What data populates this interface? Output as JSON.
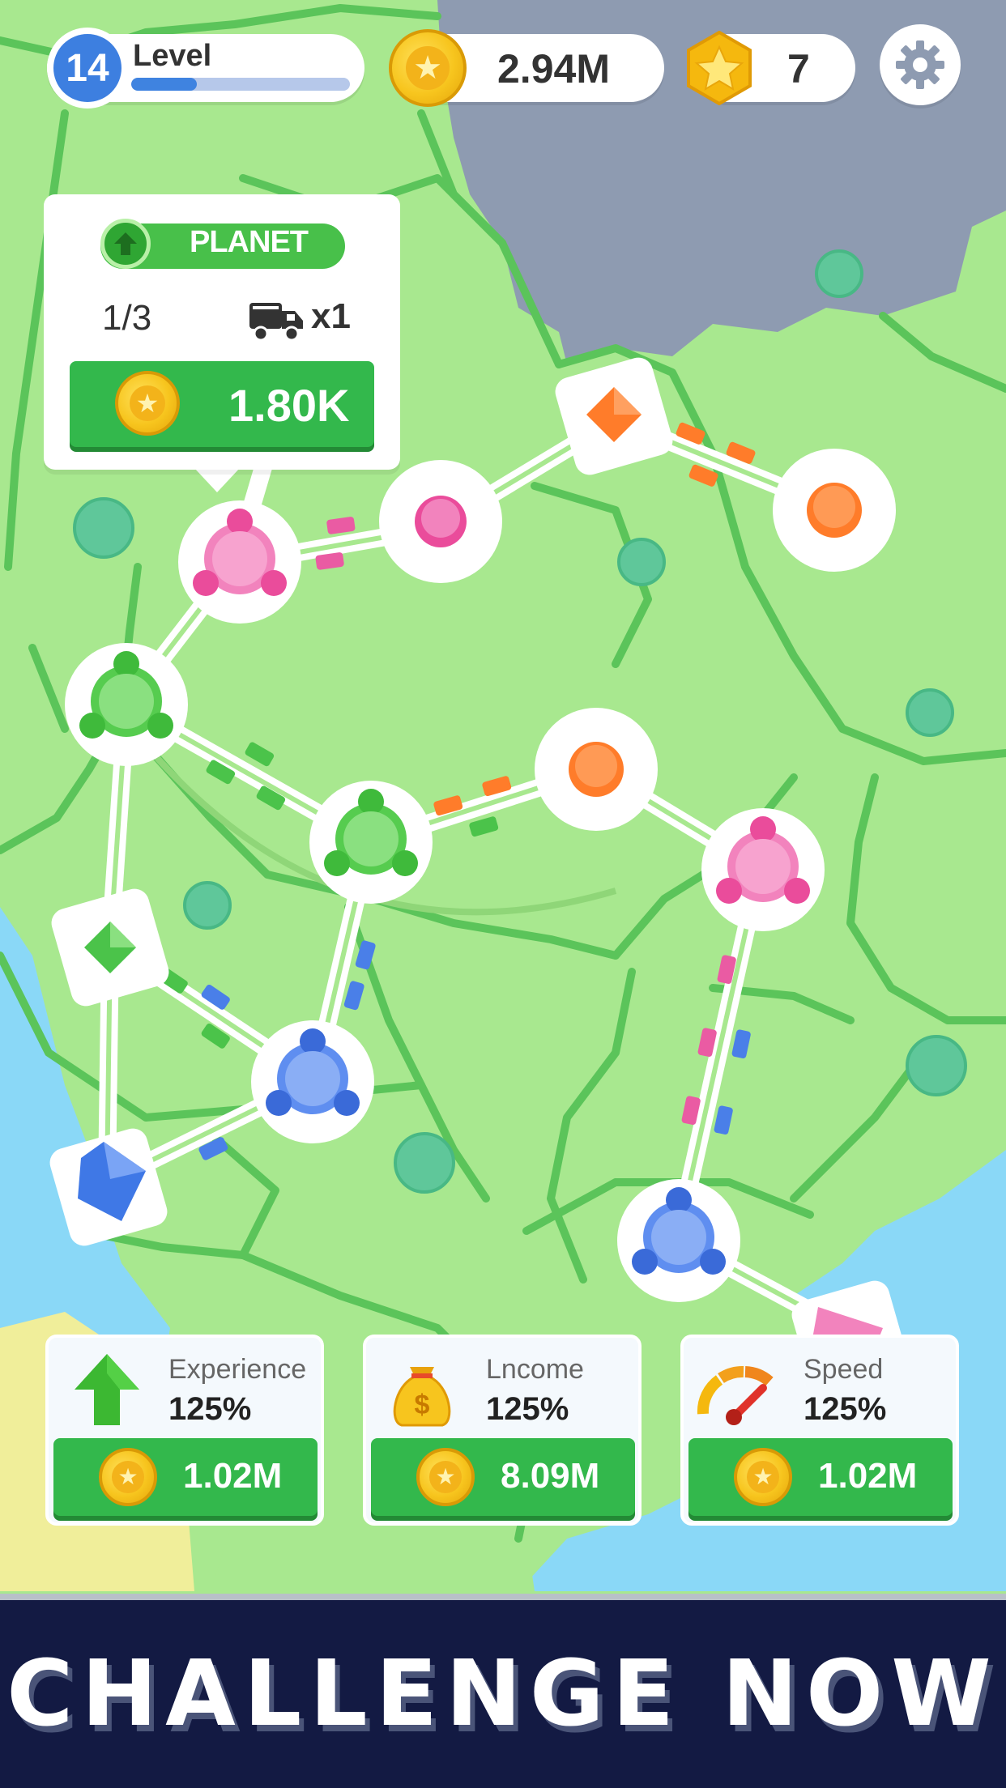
{
  "hud": {
    "level_number": "14",
    "level_label": "Level",
    "level_progress": 0.3,
    "coins_value": "2.94M",
    "stars_value": "7",
    "coin_icon": "coin-star-icon",
    "star_icon": "star-hex-icon",
    "settings_icon": "gear-icon"
  },
  "planet_card": {
    "tag_label": "PLANET",
    "progress": "1/3",
    "trucks_count": "x1",
    "buy_cost": "1.80K"
  },
  "upgrades": [
    {
      "name": "Experience",
      "percent": "125%",
      "cost": "1.02M",
      "icon": "green-arrow-up-icon"
    },
    {
      "name": "Lncome",
      "percent": "125%",
      "cost": "8.09M",
      "icon": "money-bag-icon"
    },
    {
      "name": "Speed",
      "percent": "125%",
      "cost": "1.02M",
      "icon": "speedometer-icon"
    }
  ],
  "challenge": {
    "label": "CHALLENGE NOW"
  },
  "colors": {
    "land": "#a8e88f",
    "border": "#5bc45a",
    "water": "#8ad8f7",
    "rock": "#8e9bb1",
    "road": "#ffffff",
    "pink": "#f283bd",
    "green": "#6fd86a",
    "blue": "#5f8ef0",
    "orange": "#ff8d3a",
    "button_green": "#33b84c",
    "banner": "#131a43"
  }
}
